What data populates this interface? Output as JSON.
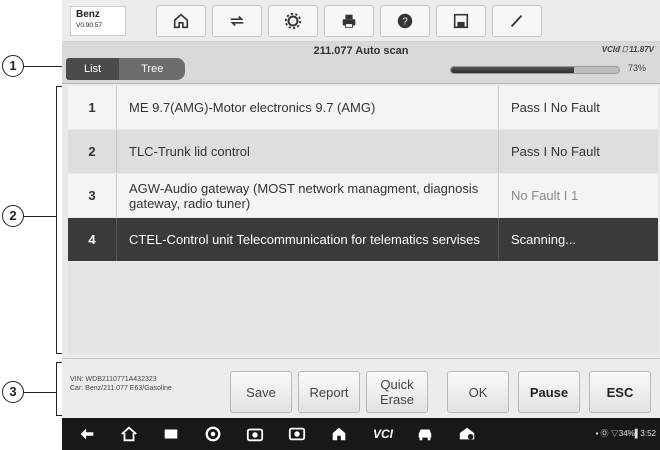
{
  "callouts": {
    "c1": "1",
    "c2": "2",
    "c3": "3"
  },
  "vehicle": {
    "make": "Benz",
    "version": "V0.90.57"
  },
  "toolbar_icons": [
    "home-icon",
    "vehicle-swap-icon",
    "settings-icon",
    "print-icon",
    "help-icon",
    "save-icon",
    "pen-icon"
  ],
  "scan": {
    "title": "211.077 Auto scan",
    "vci_status": "VCIᵭ  ⎕ 11.87V",
    "tabs": [
      {
        "label": "List"
      },
      {
        "label": "Tree"
      }
    ],
    "progress_percent": 73,
    "progress_label": "73%"
  },
  "systems": [
    {
      "num": "1",
      "name": "ME 9.7(AMG)-Motor electronics 9.7 (AMG)",
      "status": "Pass I No Fault"
    },
    {
      "num": "2",
      "name": "TLC-Trunk lid control",
      "status": "Pass I No Fault"
    },
    {
      "num": "3",
      "name": "AGW-Audio gateway (MOST network managment, diagnosis gateway, radio tuner)",
      "status": "No Fault I 1"
    },
    {
      "num": "4",
      "name": "CTEL-Control unit Telecommunication for telematics servises",
      "status": "Scanning..."
    }
  ],
  "footer": {
    "vin": "VIN: WDB2110771A432323",
    "car": "Car: Benz/211.077 E63/Gasoline",
    "buttons": {
      "save": "Save",
      "report": "Report",
      "quick_erase": "Quick Erase",
      "ok": "OK",
      "pause": "Pause",
      "esc": "ESC"
    }
  },
  "navbar": {
    "vci_label": "VCI",
    "status_text": "▪ Ⓞ ▽34%▌3:52"
  },
  "colors": {
    "selected_row": "#3a3a3a",
    "progress_fill": "#333333"
  }
}
